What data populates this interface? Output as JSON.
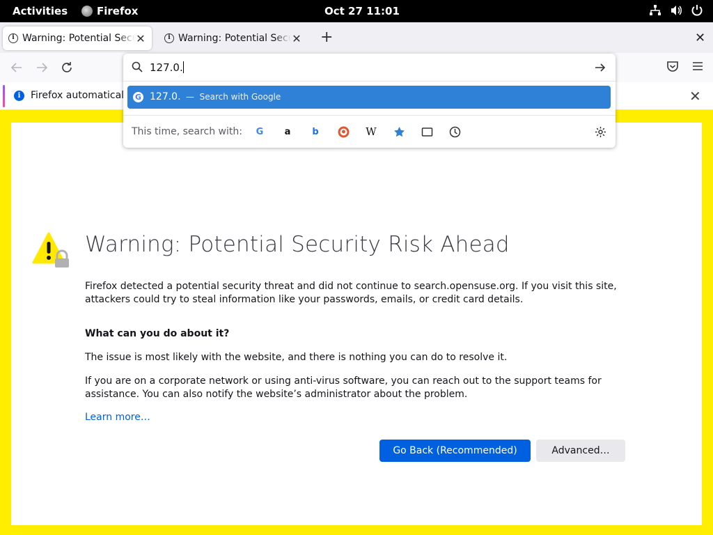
{
  "topbar": {
    "activities": "Activities",
    "app_name": "Firefox",
    "clock": "Oct 27  11:01",
    "tray_icons": [
      "network-icon",
      "volume-icon",
      "power-icon"
    ]
  },
  "tabs": [
    {
      "title": "Warning: Potential Security Risk Ahead",
      "active": true
    },
    {
      "title": "Warning: Potential Security Risk Ahead",
      "active": false
    }
  ],
  "new_tab_label": "+",
  "close_window_label": "✕",
  "urlbar": {
    "value": "127.0.",
    "suggestion_text": "127.0.",
    "suggestion_separator": "—",
    "suggestion_action": "Search with Google",
    "search_with_label": "This time, search with:",
    "engines": [
      "Google",
      "Amazon",
      "Bing",
      "DuckDuckGo",
      "Wikipedia",
      "Bookmarks",
      "Tabs",
      "History"
    ]
  },
  "notification": {
    "text": "Firefox automatically"
  },
  "page": {
    "heading": "Warning: Potential Security Risk Ahead",
    "paragraph1": "Firefox detected a potential security threat and did not continue to search.opensuse.org. If you visit this site, attackers could try to steal information like your passwords, emails, or credit card details.",
    "question": "What can you do about it?",
    "paragraph2": "The issue is most likely with the website, and there is nothing you can do to resolve it.",
    "paragraph3": "If you are on a corporate network or using anti-virus software, you can reach out to the support teams for assistance. You can also notify the website’s administrator about the problem.",
    "learn_more": "Learn more…",
    "go_back_button": "Go Back (Recommended)",
    "advanced_button": "Advanced…"
  },
  "colors": {
    "page_border": "#ffee00",
    "primary_button": "#0060df",
    "selected_result": "#2f80d7",
    "warning_icon": "#ffe900"
  }
}
